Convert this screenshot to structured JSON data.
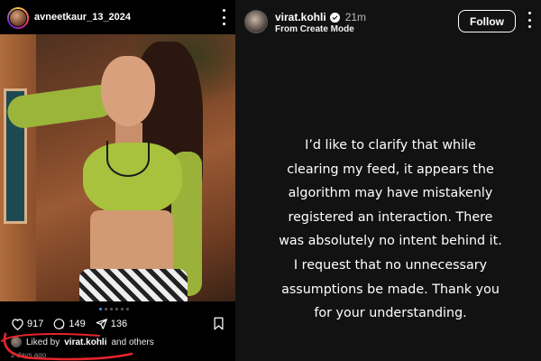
{
  "post": {
    "username": "avneetkaur_13_2024",
    "likes_count": "917",
    "comments_count": "149",
    "shares_count": "136",
    "liked_by_prefix": "Liked by",
    "liked_by_user": "virat.kohli",
    "liked_by_suffix": "and others",
    "time_ago": "2 days ago",
    "carousel_pages": 6,
    "carousel_active_index": 0
  },
  "story": {
    "username": "virat.kohli",
    "time": "21m",
    "subtitle": "From Create Mode",
    "follow_label": "Follow",
    "lines": [
      "I’d like to clarify that while",
      "clearing my feed, it appears the",
      "algorithm may have mistakenly",
      "registered an interaction. There",
      "was absolutely no intent behind it.",
      "I request that no unnecessary",
      "assumptions be made. Thank you",
      "for your understanding."
    ]
  },
  "colors": {
    "background_left": "#000000",
    "background_right": "#121212",
    "annotation_red": "#e5242b",
    "carousel_active": "#3897f0",
    "verified_badge": "#0095f6"
  },
  "icons": [
    "heart-icon",
    "comment-icon",
    "share-icon",
    "bookmark-icon",
    "more-options-icon",
    "verified-badge-icon"
  ]
}
